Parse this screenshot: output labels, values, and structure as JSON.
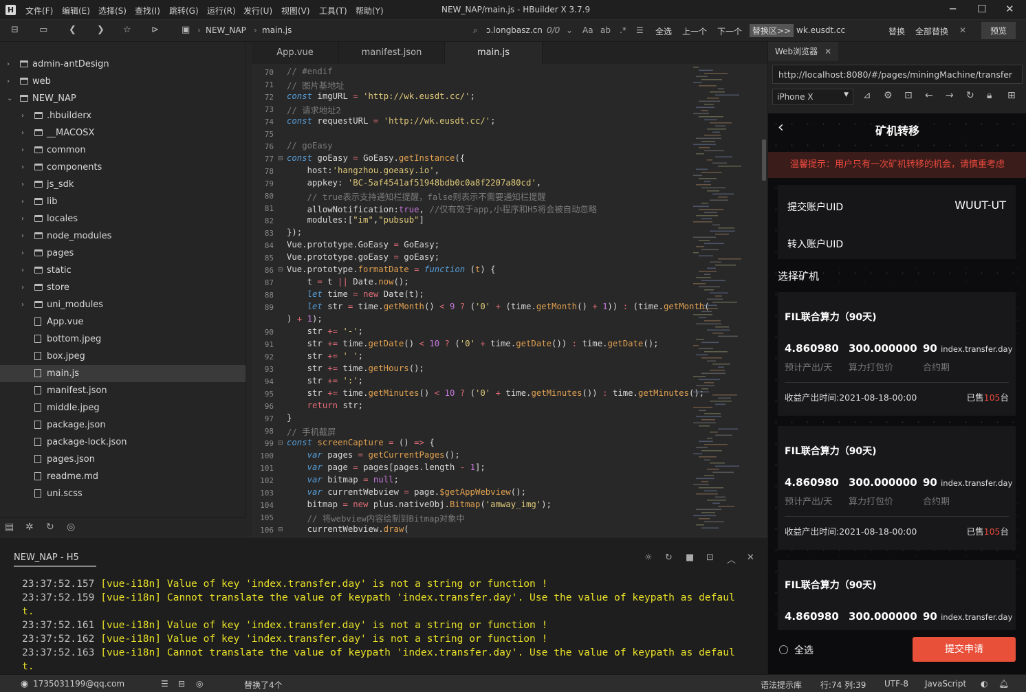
{
  "menu": [
    "文件(F)",
    "编辑(E)",
    "选择(S)",
    "查找(I)",
    "跳转(G)",
    "运行(R)",
    "发行(U)",
    "视图(V)",
    "工具(T)",
    "帮助(Y)"
  ],
  "window_title": "NEW_NAP/main.js - HBuilder X 3.7.9",
  "toolbar": {
    "project": "NEW_NAP",
    "file": "main.js",
    "search_value": "ɔ.longbasz.cn",
    "match_count": "0/0",
    "select_all": "全选",
    "prev": "上一个",
    "next": "下一个",
    "replace_scope": "替换区>>",
    "replace_value": "wk.eusdt.cc",
    "replace": "替换",
    "replace_all": "全部替换",
    "preview": "预览"
  },
  "tree": [
    {
      "label": "admin-antDesign",
      "type": "folder",
      "level": 0,
      "arrow": "›"
    },
    {
      "label": "web",
      "type": "folder",
      "level": 0,
      "arrow": "›"
    },
    {
      "label": "NEW_NAP",
      "type": "project",
      "level": 0,
      "arrow": "⌄"
    },
    {
      "label": ".hbuilderx",
      "type": "folder",
      "level": 1,
      "arrow": "›"
    },
    {
      "label": "__MACOSX",
      "type": "folder",
      "level": 1,
      "arrow": "›"
    },
    {
      "label": "common",
      "type": "folder",
      "level": 1,
      "arrow": "›"
    },
    {
      "label": "components",
      "type": "folder",
      "level": 1,
      "arrow": "›"
    },
    {
      "label": "js_sdk",
      "type": "folder",
      "level": 1,
      "arrow": "›"
    },
    {
      "label": "lib",
      "type": "folder",
      "level": 1,
      "arrow": "›"
    },
    {
      "label": "locales",
      "type": "folder",
      "level": 1,
      "arrow": "›"
    },
    {
      "label": "node_modules",
      "type": "folder",
      "level": 1,
      "arrow": "›"
    },
    {
      "label": "pages",
      "type": "folder",
      "level": 1,
      "arrow": "›"
    },
    {
      "label": "static",
      "type": "folder",
      "level": 1,
      "arrow": "›"
    },
    {
      "label": "store",
      "type": "folder",
      "level": 1,
      "arrow": "›"
    },
    {
      "label": "uni_modules",
      "type": "folder",
      "level": 1,
      "arrow": "›"
    },
    {
      "label": "App.vue",
      "type": "file",
      "level": 1,
      "arrow": ""
    },
    {
      "label": "bottom.jpeg",
      "type": "file",
      "level": 1,
      "arrow": ""
    },
    {
      "label": "box.jpeg",
      "type": "file",
      "level": 1,
      "arrow": ""
    },
    {
      "label": "main.js",
      "type": "file",
      "level": 1,
      "arrow": "",
      "active": true
    },
    {
      "label": "manifest.json",
      "type": "file",
      "level": 1,
      "arrow": ""
    },
    {
      "label": "middle.jpeg",
      "type": "file",
      "level": 1,
      "arrow": ""
    },
    {
      "label": "package.json",
      "type": "file",
      "level": 1,
      "arrow": ""
    },
    {
      "label": "package-lock.json",
      "type": "file",
      "level": 1,
      "arrow": ""
    },
    {
      "label": "pages.json",
      "type": "file",
      "level": 1,
      "arrow": ""
    },
    {
      "label": "readme.md",
      "type": "file",
      "level": 1,
      "arrow": ""
    },
    {
      "label": "uni.scss",
      "type": "file",
      "level": 1,
      "arrow": ""
    }
  ],
  "tabs": [
    "App.vue",
    "manifest.json",
    "main.js"
  ],
  "code": [
    {
      "n": "70",
      "h": "<span class='c'>// #endif</span>"
    },
    {
      "n": "71",
      "h": "<span class='c'>// 图片基地址</span>"
    },
    {
      "n": "72",
      "h": "<span class='k'>const</span> imgURL <span class='o'>=</span> <span class='s'>'http://wk.eusdt.cc/'</span>;"
    },
    {
      "n": "73",
      "h": "<span class='c'>// 请求地址2</span>"
    },
    {
      "n": "74",
      "h": "<span class='k'>const</span> requestURL <span class='o'>=</span> <span class='s'>'http://wk.eusdt.cc/'</span>;"
    },
    {
      "n": "75",
      "h": ""
    },
    {
      "n": "76",
      "h": "<span class='c'>// goEasy</span>"
    },
    {
      "n": "77",
      "h": "<span class='k'>const</span> goEasy <span class='o'>=</span> GoEasy.<span class='f'>getInstance</span>({",
      "fold": true
    },
    {
      "n": "78",
      "h": "    host:<span class='s'>'hangzhou.goeasy.io'</span>,"
    },
    {
      "n": "79",
      "h": "    appkey: <span class='s'>'BC-5af4541af51948bdb0c0a8f2207a80cd'</span>,"
    },
    {
      "n": "80",
      "h": "    <span class='c'>// true表示支持通知栏提醒，false则表示不需要通知栏提醒</span>"
    },
    {
      "n": "81",
      "h": "    allowNotification:<span class='n'>true</span>, <span class='c'>//仅有效于app,小程序和H5将会被自动忽略</span>"
    },
    {
      "n": "82",
      "h": "    modules:[<span class='s'>\"im\"</span>,<span class='s'>\"pubsub\"</span>]"
    },
    {
      "n": "83",
      "h": "});"
    },
    {
      "n": "84",
      "h": "Vue.prototype.GoEasy <span class='o'>=</span> GoEasy;"
    },
    {
      "n": "85",
      "h": "Vue.prototype.goEasy <span class='o'>=</span> goEasy;"
    },
    {
      "n": "86",
      "h": "Vue.prototype.<span class='f'>formatDate</span> <span class='o'>=</span> <span class='k'>function</span> (<span class='f'>t</span>) {",
      "fold": true
    },
    {
      "n": "87",
      "h": "    t <span class='o'>=</span> t <span class='o'>||</span> Date.<span class='f'>now</span>();"
    },
    {
      "n": "88",
      "h": "    <span class='k'>let</span> time <span class='o'>=</span> <span class='o'>new</span> Date(t);"
    },
    {
      "n": "89",
      "h": "    <span class='k'>let</span> str <span class='o'>=</span> time.<span class='f'>getMonth</span>() <span class='o'>&lt;</span> <span class='n'>9</span> <span class='o'>?</span> (<span class='s'>'0'</span> <span class='o'>+</span> (time.<span class='f'>getMonth</span>() <span class='o'>+</span> <span class='n'>1</span>)) <span class='o'>:</span> (time.<span class='f'>getMonth</span>("
    },
    {
      "n": "",
      "h": ") <span class='o'>+</span> <span class='n'>1</span>);",
      "wrap": true
    },
    {
      "n": "90",
      "h": "    str <span class='o'>+=</span> <span class='s'>'-'</span>;"
    },
    {
      "n": "91",
      "h": "    str <span class='o'>+=</span> time.<span class='f'>getDate</span>() <span class='o'>&lt;</span> <span class='n'>10</span> <span class='o'>?</span> (<span class='s'>'0'</span> <span class='o'>+</span> time.<span class='f'>getDate</span>()) <span class='o'>:</span> time.<span class='f'>getDate</span>();"
    },
    {
      "n": "92",
      "h": "    str <span class='o'>+=</span> <span class='s'>' '</span>;"
    },
    {
      "n": "93",
      "h": "    str <span class='o'>+=</span> time.<span class='f'>getHours</span>();"
    },
    {
      "n": "94",
      "h": "    str <span class='o'>+=</span> <span class='s'>':'</span>;"
    },
    {
      "n": "95",
      "h": "    str <span class='o'>+=</span> time.<span class='f'>getMinutes</span>() <span class='o'>&lt;</span> <span class='n'>10</span> <span class='o'>?</span> (<span class='s'>'0'</span> <span class='o'>+</span> time.<span class='f'>getMinutes</span>()) <span class='o'>:</span> time.<span class='f'>getMinutes</span>();"
    },
    {
      "n": "96",
      "h": "    <span class='o'>return</span> str;"
    },
    {
      "n": "97",
      "h": "}"
    },
    {
      "n": "98",
      "h": "<span class='c'>// 手机截屏</span>"
    },
    {
      "n": "99",
      "h": "<span class='k'>const</span> <span class='f'>screenCapture</span> <span class='o'>=</span> () <span class='o'>=&gt;</span> {",
      "fold": true
    },
    {
      "n": "100",
      "h": "    <span class='k'>var</span> pages <span class='o'>=</span> <span class='f'>getCurrentPages</span>();"
    },
    {
      "n": "101",
      "h": "    <span class='k'>var</span> page <span class='o'>=</span> pages[pages.length <span class='o'>-</span> <span class='n'>1</span>];"
    },
    {
      "n": "102",
      "h": "    <span class='k'>var</span> bitmap <span class='o'>=</span> <span class='n'>null</span>;"
    },
    {
      "n": "103",
      "h": "    <span class='k'>var</span> currentWebview <span class='o'>=</span> page.<span class='f'>$getAppWebview</span>();"
    },
    {
      "n": "104",
      "h": "    bitmap <span class='o'>=</span> <span class='o'>new</span> plus.nativeObj.<span class='f'>Bitmap</span>(<span class='s'>'amway_img'</span>);"
    },
    {
      "n": "105",
      "h": "    <span class='c'>// 将webview内容绘制到Bitmap对象中</span>"
    },
    {
      "n": "106",
      "h": "    currentWebview.<span class='f'>draw</span>(",
      "fold": true
    }
  ],
  "console": {
    "tab": "NEW_NAP - H5",
    "logs": [
      {
        "t": "23:37:52.157",
        "m": "[vue-i18n] Value of key 'index.transfer.day' is not a string or function !"
      },
      {
        "t": "23:37:52.159",
        "m": "[vue-i18n] Cannot translate the value of keypath 'index.transfer.day'. Use the value of keypath as defaul"
      },
      {
        "t": "",
        "m": "t."
      },
      {
        "t": "23:37:52.161",
        "m": "[vue-i18n] Value of key 'index.transfer.day' is not a string or function !"
      },
      {
        "t": "23:37:52.162",
        "m": "[vue-i18n] Value of key 'index.transfer.day' is not a string or function !"
      },
      {
        "t": "23:37:52.163",
        "m": "[vue-i18n] Cannot translate the value of keypath 'index.transfer.day'. Use the value of keypath as defaul"
      },
      {
        "t": "",
        "m": "t."
      }
    ]
  },
  "status": {
    "user": "1735031199@qq.com",
    "message": "替换了4个",
    "syntax": "语法提示库",
    "position": "行:74  列:39",
    "encoding": "UTF-8",
    "language": "JavaScript"
  },
  "browser": {
    "tab": "Web浏览器",
    "url": "http://localhost:8080/#/pages/miningMachine/transfer",
    "device": "iPhone X"
  },
  "phone": {
    "title": "矿机转移",
    "notice": "温馨提示：用户只有一次矿机转移的机会，请慎重考虑",
    "submit_uid_label": "提交账户UID",
    "submit_uid_value": "WUUT-UT",
    "transfer_uid_label": "转入账户UID",
    "section": "选择矿机",
    "cards": [
      {
        "title": "FIL联合算力（90天)",
        "v1": "4.860980",
        "v2": "300.000000",
        "v3": "90",
        "v3s": "index.transfer.day",
        "l1": "预计产出/天",
        "l2": "算力打包价",
        "l3": "合约期",
        "date": "收益产出时间:2021-08-18-00:00",
        "sold_pre": "已售",
        "sold": "105",
        "sold_unit": "台"
      },
      {
        "title": "FIL联合算力（90天)",
        "v1": "4.860980",
        "v2": "300.000000",
        "v3": "90",
        "v3s": "index.transfer.day",
        "l1": "预计产出/天",
        "l2": "算力打包价",
        "l3": "合约期",
        "date": "收益产出时间:2021-08-18-00:00",
        "sold_pre": "已售",
        "sold": "105",
        "sold_unit": "台"
      },
      {
        "title": "FIL联合算力（90天)",
        "v1": "4.860980",
        "v2": "300.000000",
        "v3": "90",
        "v3s": "index.transfer.day",
        "l1": "",
        "l2": "",
        "l3": "",
        "date": "",
        "sold_pre": "",
        "sold": "",
        "sold_unit": ""
      }
    ],
    "select_all": "全选",
    "submit": "提交申请"
  }
}
